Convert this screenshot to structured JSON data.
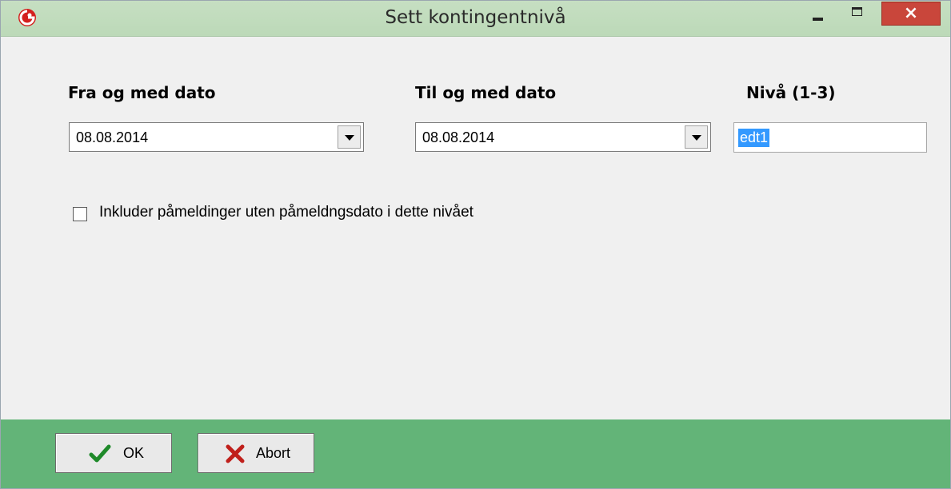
{
  "window": {
    "title": "Sett kontingentnivå",
    "close_glyph": "×",
    "icons": {
      "app": "red-swirl-logo-icon",
      "minimize": "minimize-icon",
      "maximize": "maximize-icon",
      "close": "close-icon"
    }
  },
  "form": {
    "from_label": "Fra og med dato",
    "from_value": "08.08.2014",
    "to_label": "Til og med dato",
    "to_value": "08.08.2014",
    "level_label": "Nivå (1-3)",
    "level_value": "edt1",
    "include_checkbox_label": "Inkluder påmeldinger uten påmeldngsdato i dette nivået",
    "include_checked": false
  },
  "footer": {
    "ok_label": "OK",
    "abort_label": "Abort",
    "ok_icon": "checkmark-icon",
    "abort_icon": "red-x-icon"
  },
  "colors": {
    "title_bar": "#bcd9b8",
    "close_button": "#c9463b",
    "footer": "#63b478",
    "selection": "#3399ff"
  }
}
